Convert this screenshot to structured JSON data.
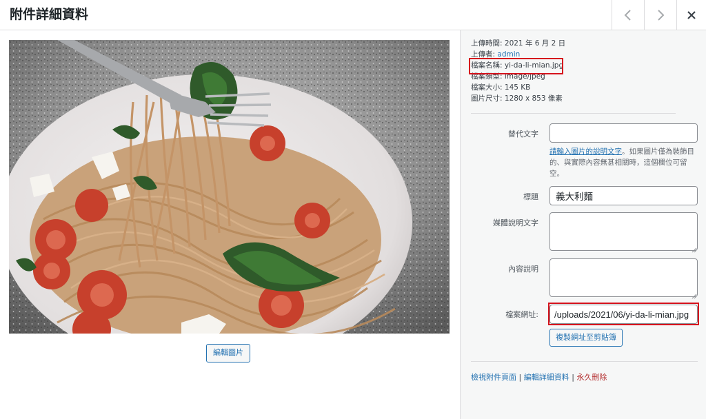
{
  "header": {
    "title": "附件詳細資料",
    "prev_icon": "chevron-left-icon",
    "next_icon": "chevron-right-icon",
    "close_icon": "close-icon"
  },
  "left": {
    "edit_image_label": "編輯圖片"
  },
  "meta": {
    "uploaded_label": "上傳時間:",
    "uploaded_value": "2021 年 6 月 2 日",
    "uploader_label": "上傳者:",
    "uploader_value": "admin",
    "filename_label": "檔案名稱:",
    "filename_value": "yi-da-li-mian.jpg",
    "filetype_label": "檔案類型:",
    "filetype_value": "image/jpeg",
    "filesize_label": "檔案大小:",
    "filesize_value": "145 KB",
    "dimensions_label": "圖片尺寸:",
    "dimensions_value": "1280 x 853 像素"
  },
  "fields": {
    "alt_label": "替代文字",
    "alt_value": "",
    "alt_note_link": "請輸入圖片的說明文字",
    "alt_note_text": "。如果圖片僅為裝飾目的、與實際內容無甚相關時，這個欄位可留空。",
    "title_label": "標題",
    "title_value": "義大利麵",
    "caption_label": "媒體說明文字",
    "caption_value": "",
    "description_label": "內容說明",
    "description_value": "",
    "url_label": "檔案網址:",
    "url_value": "/uploads/2021/06/yi-da-li-mian.jpg",
    "copy_url_label": "複製網址至剪貼簿"
  },
  "actions": {
    "view_label": "檢視附件頁面",
    "separator": "|",
    "edit_label": "編輯詳細資料",
    "delete_label": "永久刪除"
  },
  "colors": {
    "link": "#2271b1",
    "delete": "#b32d2e",
    "highlight": "#d6131d",
    "sidebar_bg": "#f6f7f7"
  }
}
